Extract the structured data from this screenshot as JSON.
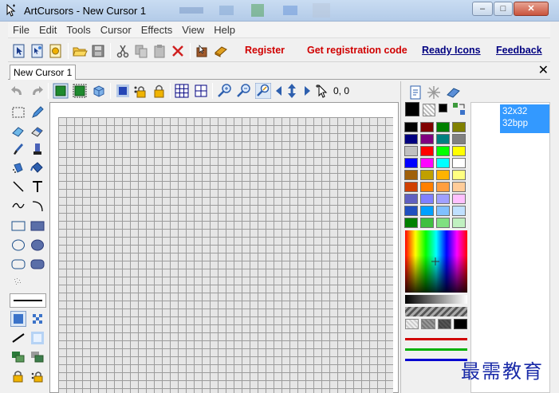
{
  "window": {
    "title": "ArtCursors - New Cursor 1",
    "minimize": "–",
    "maximize": "□",
    "close": "✕"
  },
  "menu": [
    "File",
    "Edit",
    "Tools",
    "Cursor",
    "Effects",
    "View",
    "Help"
  ],
  "toolbar_links": {
    "register": "Register",
    "get_code": "Get registration code",
    "ready_icons": "Ready Icons",
    "feedback": "Feedback"
  },
  "tabs": {
    "active": "New Cursor 1",
    "close": "✕"
  },
  "toolbar2": {
    "coords": "0, 0"
  },
  "sizes": [
    {
      "line1": "32x32",
      "line2": "32bpp"
    }
  ],
  "colors": {
    "accent_link": "#d00000",
    "link_blue": "#000080",
    "selection": "#3399ff",
    "palette": [
      [
        "#000000",
        "#800000",
        "#008000",
        "#808000"
      ],
      [
        "#000080",
        "#800080",
        "#008080",
        "#808080"
      ],
      [
        "#c0c0c0",
        "#ff0000",
        "#00ff00",
        "#ffff00"
      ],
      [
        "#0000ff",
        "#ff00ff",
        "#00ffff",
        "#ffffff"
      ],
      [
        "#a0600a",
        "#c0a000",
        "#ffb300",
        "#ffff80"
      ],
      [
        "#d04000",
        "#ff8000",
        "#ff9f40",
        "#ffcc99"
      ],
      [
        "#6060c0",
        "#8080ff",
        "#a0a0ff",
        "#ffc0ff"
      ],
      [
        "#2050c0",
        "#00a0ff",
        "#80c0ff",
        "#c0e0ff"
      ],
      [
        "#008000",
        "#40c040",
        "#80e080",
        "#c0f0c0"
      ]
    ]
  },
  "watermark": "最需教育"
}
